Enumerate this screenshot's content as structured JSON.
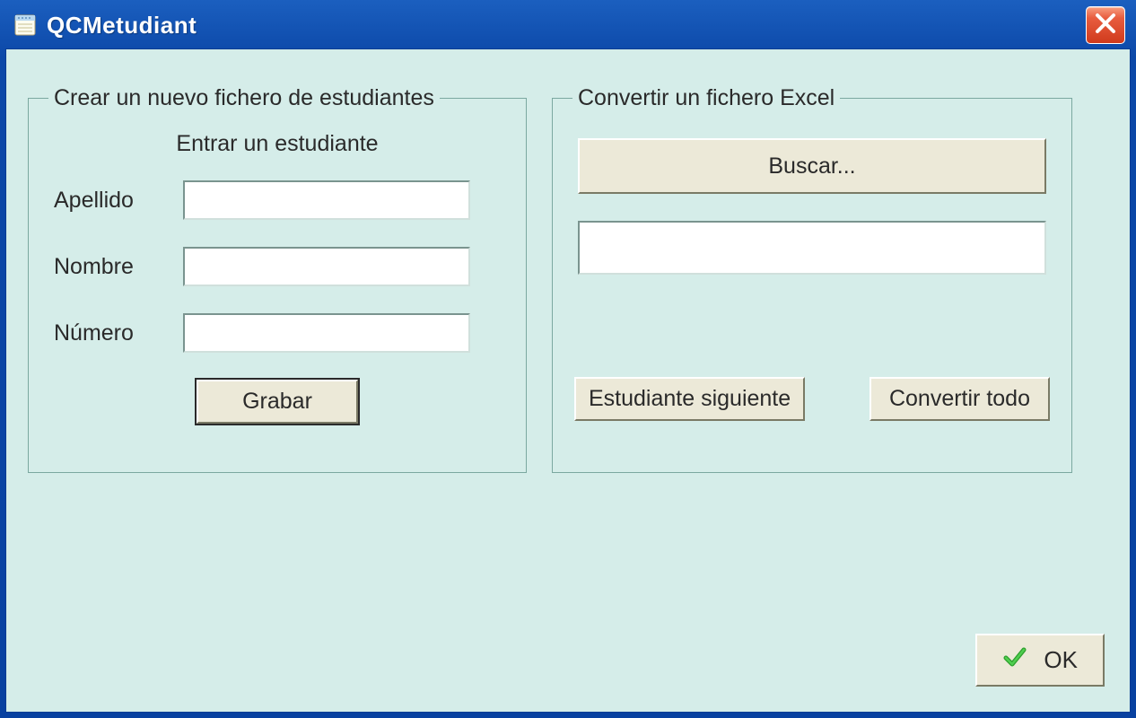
{
  "window": {
    "title": "QCMetudiant"
  },
  "groupLeft": {
    "legend": "Crear un nuevo fichero de estudiantes",
    "subheader": "Entrar un estudiante",
    "fields": {
      "apellido": {
        "label": "Apellido",
        "value": ""
      },
      "nombre": {
        "label": "Nombre",
        "value": ""
      },
      "numero": {
        "label": "Número",
        "value": ""
      }
    },
    "saveButton": "Grabar"
  },
  "groupRight": {
    "legend": "Convertir un fichero Excel",
    "browseButton": "Buscar...",
    "fileValue": "",
    "nextStudentButton": "Estudiante siguiente",
    "convertAllButton": "Convertir todo"
  },
  "okButton": "OK"
}
